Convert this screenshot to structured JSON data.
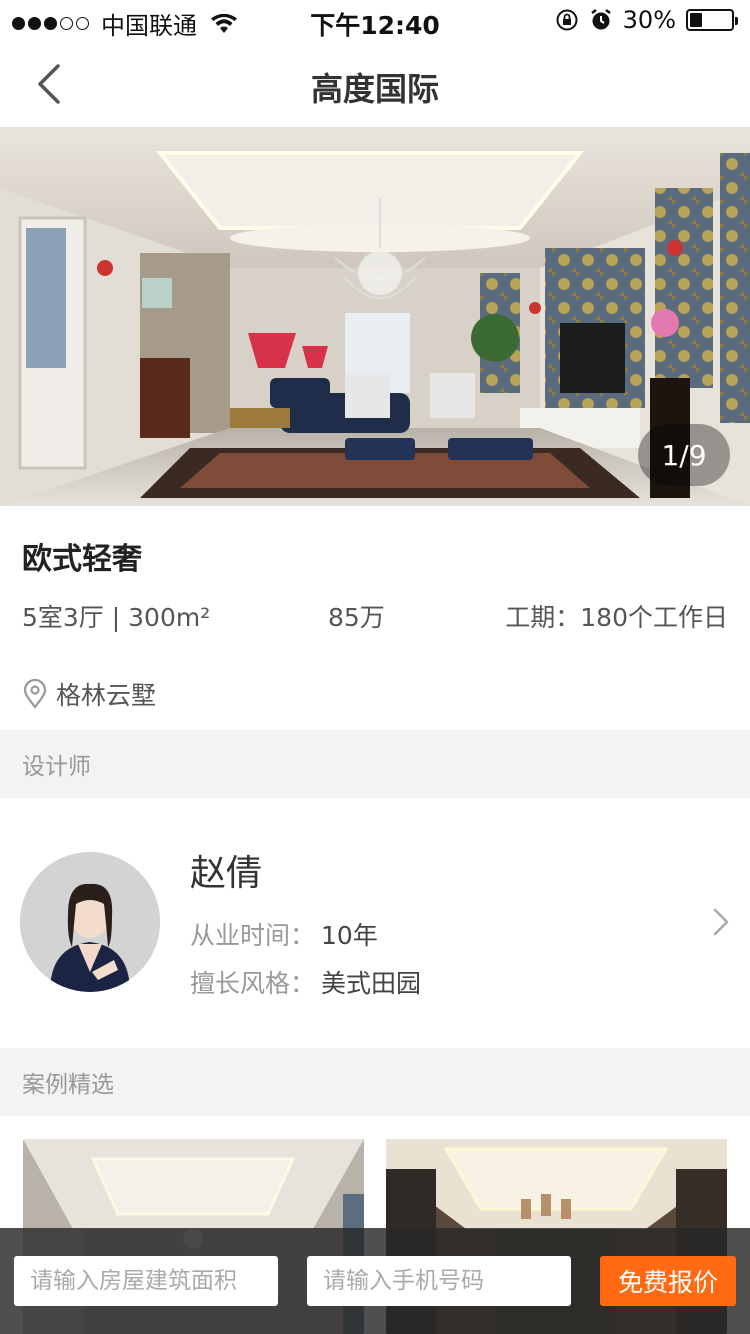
{
  "status_bar": {
    "carrier": "中国联通",
    "time": "下午12:40",
    "battery_text": "30%",
    "battery_level": 0.3,
    "icons": [
      "signal-icon",
      "wifi-icon",
      "orientation-lock-icon",
      "alarm-icon",
      "battery-icon"
    ]
  },
  "nav": {
    "title": "高度国际",
    "back_icon": "back-chevron-icon"
  },
  "gallery": {
    "counter": "1/9"
  },
  "project": {
    "title": "欧式轻奢",
    "area": "5室3厅 | 300m²",
    "price": "85万",
    "period": "工期：180个工作日",
    "location": "格林云墅",
    "location_icon": "location-pin-icon"
  },
  "designer_section": {
    "label": "设计师",
    "name": "赵倩",
    "years_label": "从业时间：",
    "years_value": "10年",
    "style_label": "擅长风格：",
    "style_value": "美式田园"
  },
  "cases_section": {
    "label": "案例精选"
  },
  "bottom_bar": {
    "area_placeholder": "请输入房屋建筑面积",
    "phone_placeholder": "请输入手机号码",
    "quote_button": "免费报价"
  },
  "colors": {
    "accent": "#ff6a13",
    "section_bg": "#f3f3f3"
  }
}
